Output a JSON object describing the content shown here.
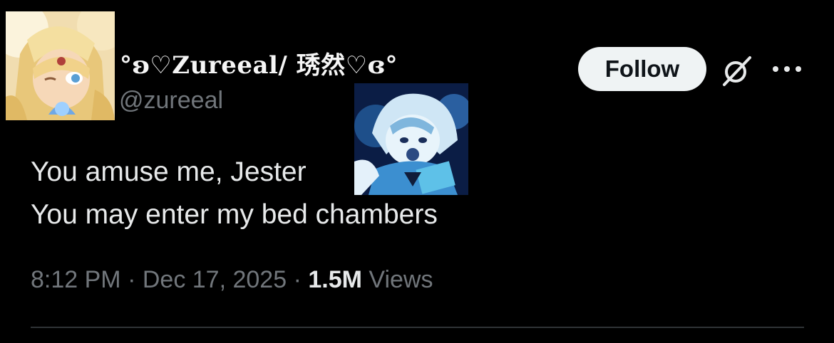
{
  "author": {
    "display_name": "°ʚ♡Zureeal/ 琇然♡ɞ°",
    "handle": "@zureeal"
  },
  "actions": {
    "follow_label": "Follow",
    "grok_icon": "grok-icon",
    "more_icon": "more-icon"
  },
  "tweet": {
    "text": "You amuse me, Jester\nYou may enter my bed chambers",
    "time": "8:12 PM",
    "separator": "·",
    "date": "Dec 17, 2025",
    "views_count": "1.5M",
    "views_label": "Views"
  },
  "colors": {
    "background": "#000000",
    "text": "#e7e9ea",
    "muted": "#71767b",
    "follow_bg": "#eff3f4",
    "divider": "#2f3336"
  }
}
